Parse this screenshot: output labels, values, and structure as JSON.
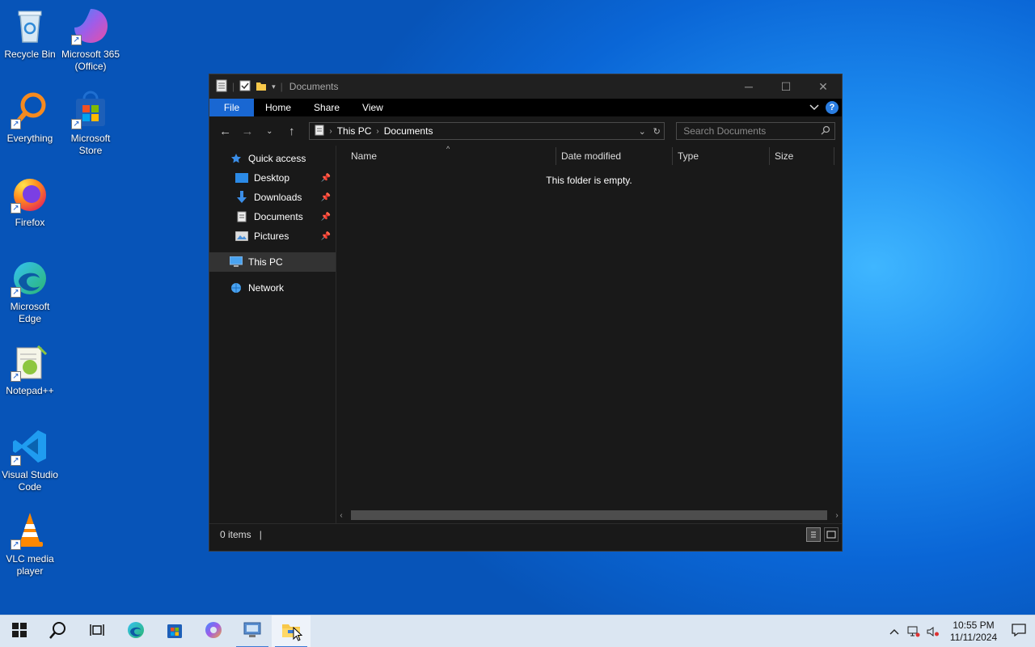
{
  "desktop": {
    "icons": [
      {
        "label": "Recycle Bin"
      },
      {
        "label": "Microsoft 365 (Office)"
      },
      {
        "label": "Everything"
      },
      {
        "label": "Microsoft Store"
      },
      {
        "label": "Firefox"
      },
      {
        "label": "Microsoft Edge"
      },
      {
        "label": "Notepad++"
      },
      {
        "label": "Visual Studio Code"
      },
      {
        "label": "VLC media player"
      }
    ]
  },
  "window": {
    "title": "Documents",
    "ribbon_tabs": [
      "File",
      "Home",
      "Share",
      "View"
    ],
    "help_label": "?",
    "address": {
      "segments": [
        "This PC",
        "Documents"
      ]
    },
    "search": {
      "placeholder": "Search Documents"
    },
    "nav": {
      "quick_access": "Quick access",
      "items": [
        {
          "label": "Desktop"
        },
        {
          "label": "Downloads"
        },
        {
          "label": "Documents"
        },
        {
          "label": "Pictures"
        }
      ],
      "this_pc": "This PC",
      "network": "Network"
    },
    "columns": [
      "Name",
      "Date modified",
      "Type",
      "Size"
    ],
    "empty_text": "This folder is empty.",
    "status": {
      "items": "0 items"
    }
  },
  "taskbar": {
    "clock_time": "10:55 PM",
    "clock_date": "11/11/2024"
  },
  "colors": {
    "accent": "#1967d2",
    "window_bg": "#191919",
    "taskbar_bg": "#dbe6f2"
  }
}
